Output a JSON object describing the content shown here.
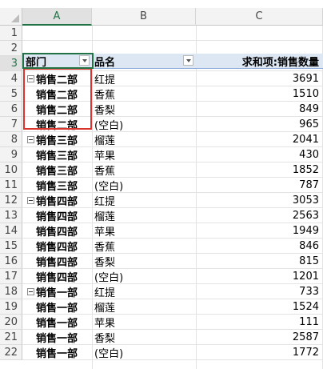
{
  "columns": [
    "A",
    "B",
    "C"
  ],
  "row_numbers": [
    "1",
    "2",
    "3",
    "4",
    "5",
    "6",
    "7",
    "8",
    "9",
    "10",
    "11",
    "12",
    "13",
    "14",
    "15",
    "16",
    "17",
    "18",
    "19",
    "20",
    "21",
    "22"
  ],
  "pivot": {
    "headers": {
      "dept": "部门",
      "product": "品名",
      "value": "求和项:销售数量"
    },
    "rows": [
      {
        "dept": "销售二部",
        "product": "红提",
        "value": "3691"
      },
      {
        "dept": "销售二部",
        "product": "香蕉",
        "value": "1510"
      },
      {
        "dept": "销售二部",
        "product": "香梨",
        "value": "849"
      },
      {
        "dept": "销售二部",
        "product": "(空白)",
        "value": "965"
      },
      {
        "dept": "销售三部",
        "product": "榴莲",
        "value": "2041"
      },
      {
        "dept": "销售三部",
        "product": "苹果",
        "value": "430"
      },
      {
        "dept": "销售三部",
        "product": "香蕉",
        "value": "1852"
      },
      {
        "dept": "销售三部",
        "product": "(空白)",
        "value": "787"
      },
      {
        "dept": "销售四部",
        "product": "红提",
        "value": "3053"
      },
      {
        "dept": "销售四部",
        "product": "榴莲",
        "value": "2563"
      },
      {
        "dept": "销售四部",
        "product": "苹果",
        "value": "1949"
      },
      {
        "dept": "销售四部",
        "product": "香蕉",
        "value": "846"
      },
      {
        "dept": "销售四部",
        "product": "香梨",
        "value": "815"
      },
      {
        "dept": "销售四部",
        "product": "(空白)",
        "value": "1201"
      },
      {
        "dept": "销售一部",
        "product": "红提",
        "value": "733"
      },
      {
        "dept": "销售一部",
        "product": "榴莲",
        "value": "1524"
      },
      {
        "dept": "销售一部",
        "product": "苹果",
        "value": "111"
      },
      {
        "dept": "销售一部",
        "product": "香梨",
        "value": "2587"
      },
      {
        "dept": "销售一部",
        "product": "(空白)",
        "value": "1772"
      }
    ]
  },
  "colors": {
    "selection": "#217346",
    "highlight_box": "#d9352d",
    "header_band": "#dde7f4"
  },
  "icons": {
    "filter": "dropdown-filter-icon",
    "collapse": "collapse-minus-icon"
  }
}
